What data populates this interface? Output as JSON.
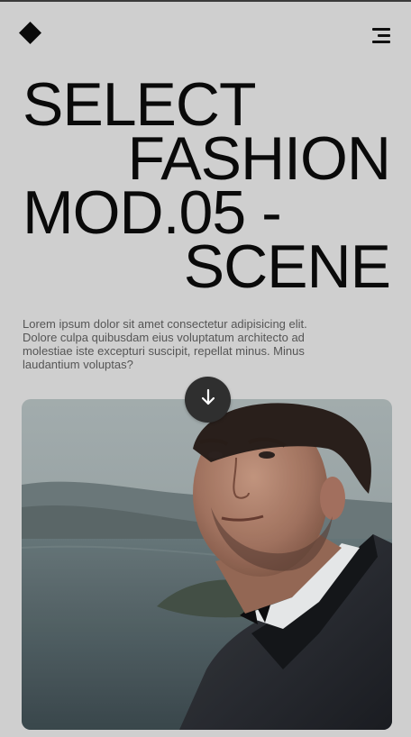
{
  "header": {
    "logo_icon": "diamond-logo-icon",
    "menu_icon": "hamburger-menu-icon"
  },
  "hero": {
    "title_lines": [
      "SELECT",
      "FASHION",
      "MOD.05 -",
      "SCENE"
    ],
    "description": "Lorem ipsum dolor sit amet consectetur adipisicing elit. Dolore culpa quibusdam eius voluptatum architecto ad molestiae iste excepturi suscipit, repellat minus. Minus laudantium voluptas?",
    "scroll_icon": "arrow-down-icon",
    "media": "photo of a man in a black tuxedo and bow tie in front of a lake and hills at dusk"
  },
  "colors": {
    "background": "#cfcfcf",
    "text": "#0b0b0b",
    "description_text": "#555555",
    "scroll_button": "#2f2f2f"
  }
}
